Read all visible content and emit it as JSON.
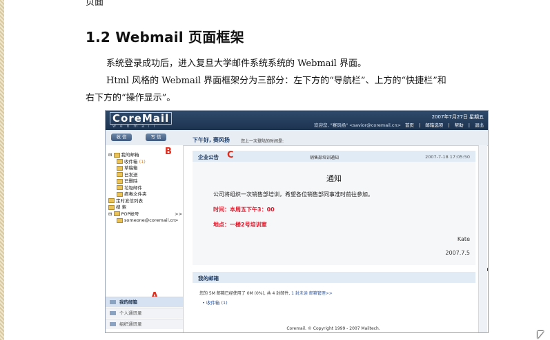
{
  "document": {
    "top_fragment": "页面",
    "heading": "1.2 Webmail 页面框架",
    "para1": "系统登录成功后，进入复旦大学邮件系统系统的 Webmail 界面。",
    "para2": "Html 风格的 Webmail 界面框架分为三部分：左下方的“导航栏”、上方的“快捷栏”和",
    "para3": "右下方的“操作显示”。"
  },
  "screenshot": {
    "logo": "CoreMail",
    "logo_sub": "webmail",
    "date": "2007年7月27日 星期五",
    "welcome": "欢迎您, \"赛风扬\" <savior@coremail.cn>",
    "header_links": [
      "首页",
      "|",
      "邮箱选项",
      "|",
      "帮助",
      "|",
      "退出"
    ],
    "buttons": {
      "receive": "收 信",
      "compose": "写 信"
    },
    "greeting": "下午好, 赛风扬",
    "greeting_sub": "您上一次登陆的时间是:",
    "tree": [
      {
        "label": "我的邮箱",
        "indent": 0,
        "prefix": "⊟"
      },
      {
        "label": "收件箱",
        "indent": 1,
        "count": "(1)"
      },
      {
        "label": "草稿箱",
        "indent": 1
      },
      {
        "label": "已发送",
        "indent": 1
      },
      {
        "label": "已删除",
        "indent": 1
      },
      {
        "label": "垃圾邮件",
        "indent": 1
      },
      {
        "label": "病毒文件夹",
        "indent": 1
      },
      {
        "label": "定时发信列表",
        "indent": 0
      },
      {
        "label": "搜 索",
        "indent": 0
      },
      {
        "label": "POP帐号",
        "indent": 0,
        "prefix": "⊟",
        "arrow": ">>"
      },
      {
        "label": "someone@coremail.cn",
        "indent": 1,
        "arrow": ">"
      }
    ],
    "markers": {
      "a": "A",
      "b": "B",
      "c": "C"
    },
    "side_tabs": [
      "我的邮箱",
      "个人通讯录",
      "组织通讯录"
    ],
    "notice": {
      "title": "企业公告",
      "subject": "销售部培训通知",
      "time": "2007-7-18 17:05:50",
      "head": "通知",
      "line1": "公司将组织一次销售部培训，希望各位销售部同事准时前往参加。",
      "line2": "时间：本周五下午3：00",
      "line3": "地点：一楼2号培训室",
      "sign": "Kate",
      "date": "2007.7.5"
    },
    "mybox": {
      "title": "我的邮箱",
      "quota_text": "您的 5M 邮箱已经使用了 0M (0%), 共 4 封邮件,",
      "unread": "1 封未读",
      "manage": "邮箱管理>>",
      "inbox": "收件箱 (1)"
    },
    "footer": "Coremail. © Copyright 1999 - 2007 Mailtech."
  },
  "colors": {
    "header": "#1d3350",
    "accent": "#e02a1a",
    "panel": "#e1ebf6"
  }
}
